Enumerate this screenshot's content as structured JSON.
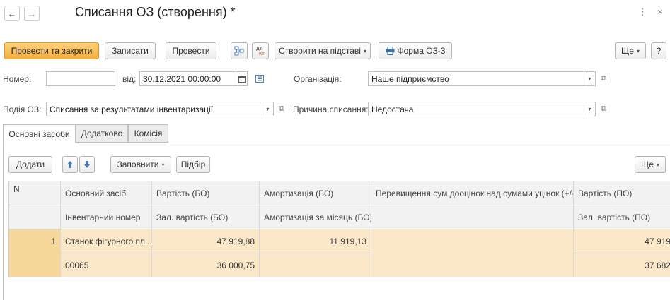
{
  "window": {
    "title": "Списання ОЗ (створення) *",
    "nav_back": "←",
    "nav_forward": "→",
    "menu_glyph": "⋮",
    "close_glyph": "×"
  },
  "toolbar": {
    "post_close": "Провести та закрити",
    "save": "Записати",
    "post": "Провести",
    "create_based": "Створити на підставі",
    "form_oz3": "Форма ОЗ-3",
    "more": "Ще",
    "help": "?"
  },
  "header": {
    "number_label": "Номер:",
    "number_value": "",
    "date_label": "від:",
    "date_value": "30.12.2021 00:00:00",
    "org_label": "Організація:",
    "org_value": "Наше підприємство",
    "event_label": "Подія ОЗ:",
    "event_value": "Списання за результатами інвентаризації",
    "reason_label": "Причина списання:",
    "reason_value": "Недостача"
  },
  "tabs": [
    {
      "label": "Основні засоби"
    },
    {
      "label": "Додатково"
    },
    {
      "label": "Комісія"
    }
  ],
  "table_toolbar": {
    "add": "Додати",
    "fill": "Заповнити",
    "pick": "Підбір",
    "more": "Ще"
  },
  "table": {
    "headers_row1": [
      "N",
      "Основний засіб",
      "Вартість (БО)",
      "Амортизація (БО)",
      "Перевищення сум дооцінок над сумами уцінок (+/-)",
      "Вартість (ПО)"
    ],
    "headers_row2": [
      "",
      "Інвентарний номер",
      "Зал. вартість (БО)",
      "Амортизація за місяць (БО)",
      "",
      "Зал. вартість (ПО)"
    ],
    "rows": [
      {
        "n": "1",
        "asset": "Станок фігурного пл...",
        "inv_number": "00065",
        "cost_bo": "47 919,88",
        "residual_bo": "36 000,75",
        "amort_bo": "11 919,13",
        "amort_month_bo": "",
        "revaluation": "",
        "cost_po": "47 919",
        "residual_po": "37 682"
      }
    ]
  },
  "colors": {
    "primary_button": "#f3ae40",
    "row_highlight": "#fbe8c8",
    "selected_cell": "#f6d79a"
  }
}
